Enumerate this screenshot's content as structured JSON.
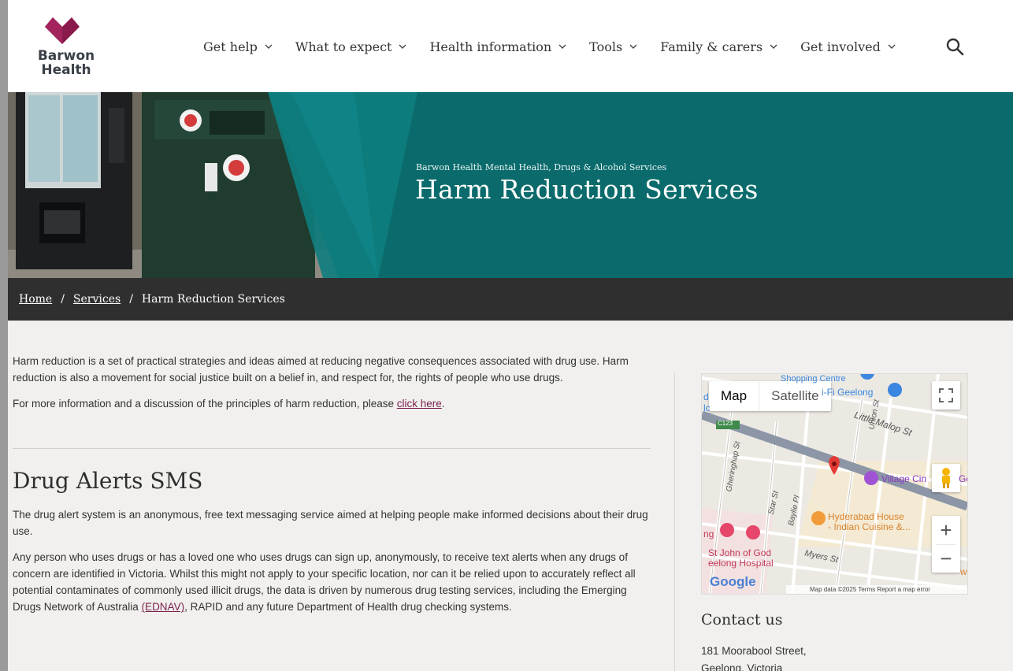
{
  "header": {
    "logo_line1": "Barwon",
    "logo_line2": "Health",
    "nav": [
      {
        "label": "Get help"
      },
      {
        "label": "What to expect"
      },
      {
        "label": "Health information"
      },
      {
        "label": "Tools"
      },
      {
        "label": "Family & carers"
      },
      {
        "label": "Get involved"
      }
    ],
    "brand_color": "#8b1a4c"
  },
  "hero": {
    "subtitle": "Barwon Health Mental Health, Drugs & Alcohol Services",
    "title": "Harm Reduction Services",
    "bg_color": "#0b6b6c"
  },
  "breadcrumb": {
    "home": "Home",
    "services": "Services",
    "current": "Harm Reduction Services",
    "separator": "/"
  },
  "main": {
    "intro": "Harm reduction is a set of practical strategies and ideas aimed at reducing negative consequences associated with drug use. Harm reduction is also a movement for social justice built on a belief in, and respect for, the rights of people who use drugs.",
    "more_info_prefix": "For more information and a discussion of the principles of harm reduction, please ",
    "more_info_link": "click here",
    "more_info_suffix": ".",
    "section_title": "Drug Alerts SMS",
    "section_p1": "The drug alert system is an anonymous, free text messaging service aimed at helping people make informed decisions about their drug use.",
    "section_p2_a": "Any person who uses drugs or has a loved one who uses drugs can sign up, anonymously, to receive text alerts when any drugs of concern are identified in Victoria. Whilst this might not apply to your specific location, nor can it be relied upon to accurately reflect all potential contaminates of commonly used illicit drugs, the data is driven by numerous drug testing services, including the Emerging Drugs Network of Australia ",
    "section_p2_link": "(EDNAV)",
    "section_p2_b": ", RAPID and any future Department of Health drug checking systems."
  },
  "map": {
    "type_map": "Map",
    "type_satellite": "Satellite",
    "labels": {
      "shopping": "Shopping Centre",
      "wifi": "i-Fi Geelong",
      "little_malop": "Little Malop St",
      "c123": "C123",
      "gheringhap": "Gheringhap St",
      "union": "Union St",
      "village": "Village Cin",
      "village_tail": "Ge",
      "star": "Star St",
      "baylie": "Baylie Pl",
      "hyderabad1": "Hyderabad House",
      "hyderabad2": "- Indian Cuisine &...",
      "stjohn1": "St John of God",
      "stjohn2": "eelong Hospital",
      "myers": "Myers St",
      "left1": "d",
      "left2": "lc",
      "left3": "ng",
      "right_w": "w"
    },
    "google": "Google",
    "attribution": "Map data ©2025   Terms   Report a map error",
    "zoom_in": "+",
    "zoom_out": "−"
  },
  "contact": {
    "title": "Contact us",
    "address1": "181 Moorabool Street,",
    "address2": "Geelong, Victoria"
  }
}
